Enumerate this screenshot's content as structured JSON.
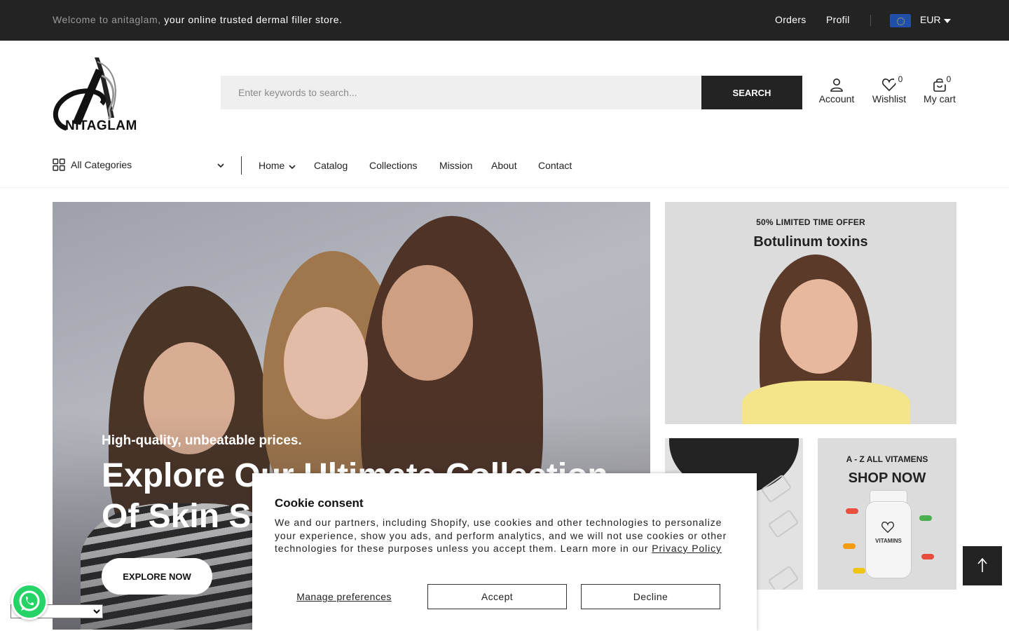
{
  "topbar": {
    "welcome_muted": "Welcome to anitaglam,",
    "welcome_strong": "your online trusted dermal filler store.",
    "orders": "Orders",
    "profil": "Profil",
    "currency": "EUR",
    "flag": "eu-flag-icon"
  },
  "header": {
    "logo_text": "NITAGLAM",
    "search_placeholder": "Enter keywords to search...",
    "search_button": "SEARCH",
    "account_label": "Account",
    "wishlist_label": "Wishlist",
    "wishlist_count": "0",
    "cart_label": "My cart",
    "cart_count": "0"
  },
  "nav": {
    "all_categories": "All Categories",
    "links": [
      "Home",
      "Catalog",
      "Collections",
      "Mission",
      "About",
      "Contact"
    ]
  },
  "hero": {
    "subtitle": "High-quality, unbeatable prices.",
    "headline": "Explore Our Ultimate Collection Of Skin Solutions",
    "cta": "EXPLORE NOW"
  },
  "banners": {
    "botox_kicker": "50% LIMITED TIME OFFER",
    "botox_title": "Botulinum toxins",
    "vit_kicker": "A - Z ALL VITAMENS",
    "vit_title": "SHOP NOW",
    "vit_jar_label": "VITAMINS"
  },
  "cookie": {
    "title": "Cookie consent",
    "body": "We and our partners, including Shopify, use cookies and other technologies to personalize your experience, show you ads, and perform analytics, and we will not use cookies or other technologies for these purposes unless you accept them. Learn more in our",
    "privacy_link": "Privacy Policy",
    "manage": "Manage preferences",
    "accept": "Accept",
    "decline": "Decline"
  },
  "colors": {
    "topbar_bg": "#232323",
    "search_btn_bg": "#232323",
    "banner_bg": "#dcdcdc"
  }
}
